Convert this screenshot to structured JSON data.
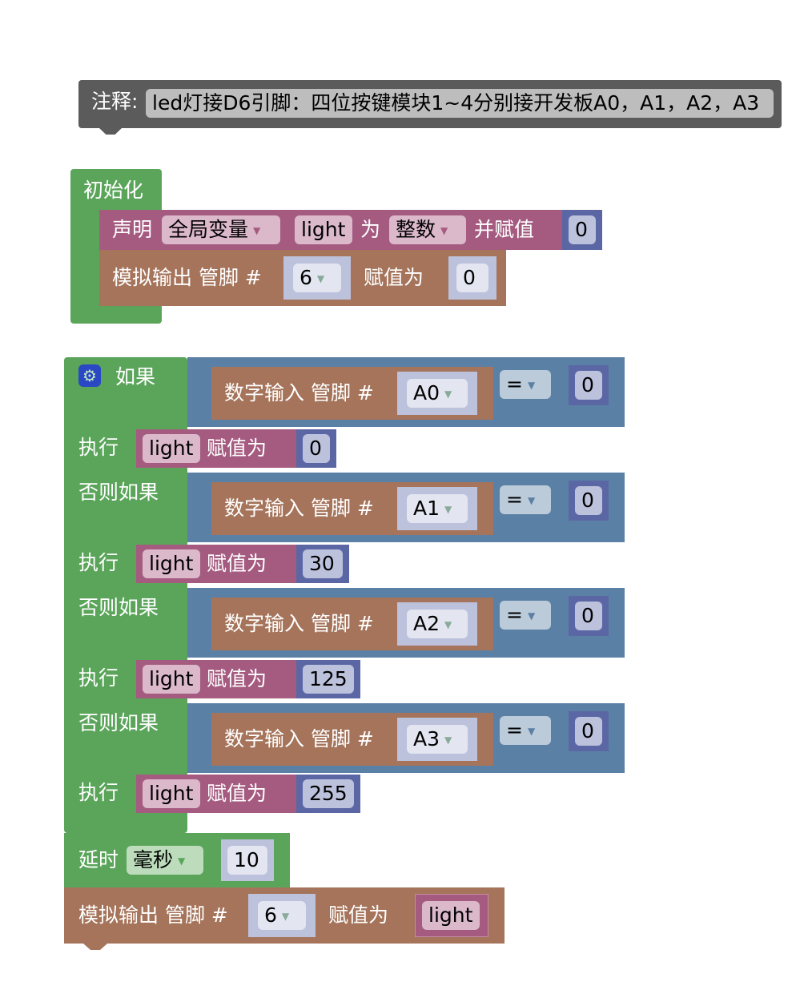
{
  "comment": {
    "label": "注释:",
    "text": "led灯接D6引脚：四位按键模块1~4分别接开发板A0，A1，A2，A3"
  },
  "setup": {
    "label": "初始化",
    "declare": {
      "label": "声明",
      "scope": "全局变量",
      "var_name": "light",
      "as_label": "为",
      "type": "整数",
      "assign_label": "并赋值",
      "value": "0"
    },
    "analog_write": {
      "label": "模拟输出 管脚 #",
      "pin": "6",
      "assign_label": "赋值为",
      "value": "0"
    }
  },
  "if_block": {
    "gear_icon": "gear-icon",
    "if_label": "如果",
    "elseif_label": "否则如果",
    "do_label": "执行",
    "branches": [
      {
        "cond_label": "数字输入 管脚 #",
        "pin": "A0",
        "op": "=",
        "cmp": "0",
        "var": "light",
        "set_label": "赋值为",
        "value": "0"
      },
      {
        "cond_label": "数字输入 管脚 #",
        "pin": "A1",
        "op": "=",
        "cmp": "0",
        "var": "light",
        "set_label": "赋值为",
        "value": "30"
      },
      {
        "cond_label": "数字输入 管脚 #",
        "pin": "A2",
        "op": "=",
        "cmp": "0",
        "var": "light",
        "set_label": "赋值为",
        "value": "125"
      },
      {
        "cond_label": "数字输入 管脚 #",
        "pin": "A3",
        "op": "=",
        "cmp": "0",
        "var": "light",
        "set_label": "赋值为",
        "value": "255"
      }
    ]
  },
  "delay": {
    "label": "延时",
    "unit": "毫秒",
    "value": "10"
  },
  "analog_write2": {
    "label": "模拟输出 管脚 #",
    "pin": "6",
    "assign_label": "赋值为",
    "value_var": "light"
  },
  "colors": {
    "comment": "#5b5b5b",
    "control": "#5ba55b",
    "variable": "#a55b80",
    "io": "#a5745b",
    "logic": "#5b80a5",
    "math": "#5b67a5"
  }
}
